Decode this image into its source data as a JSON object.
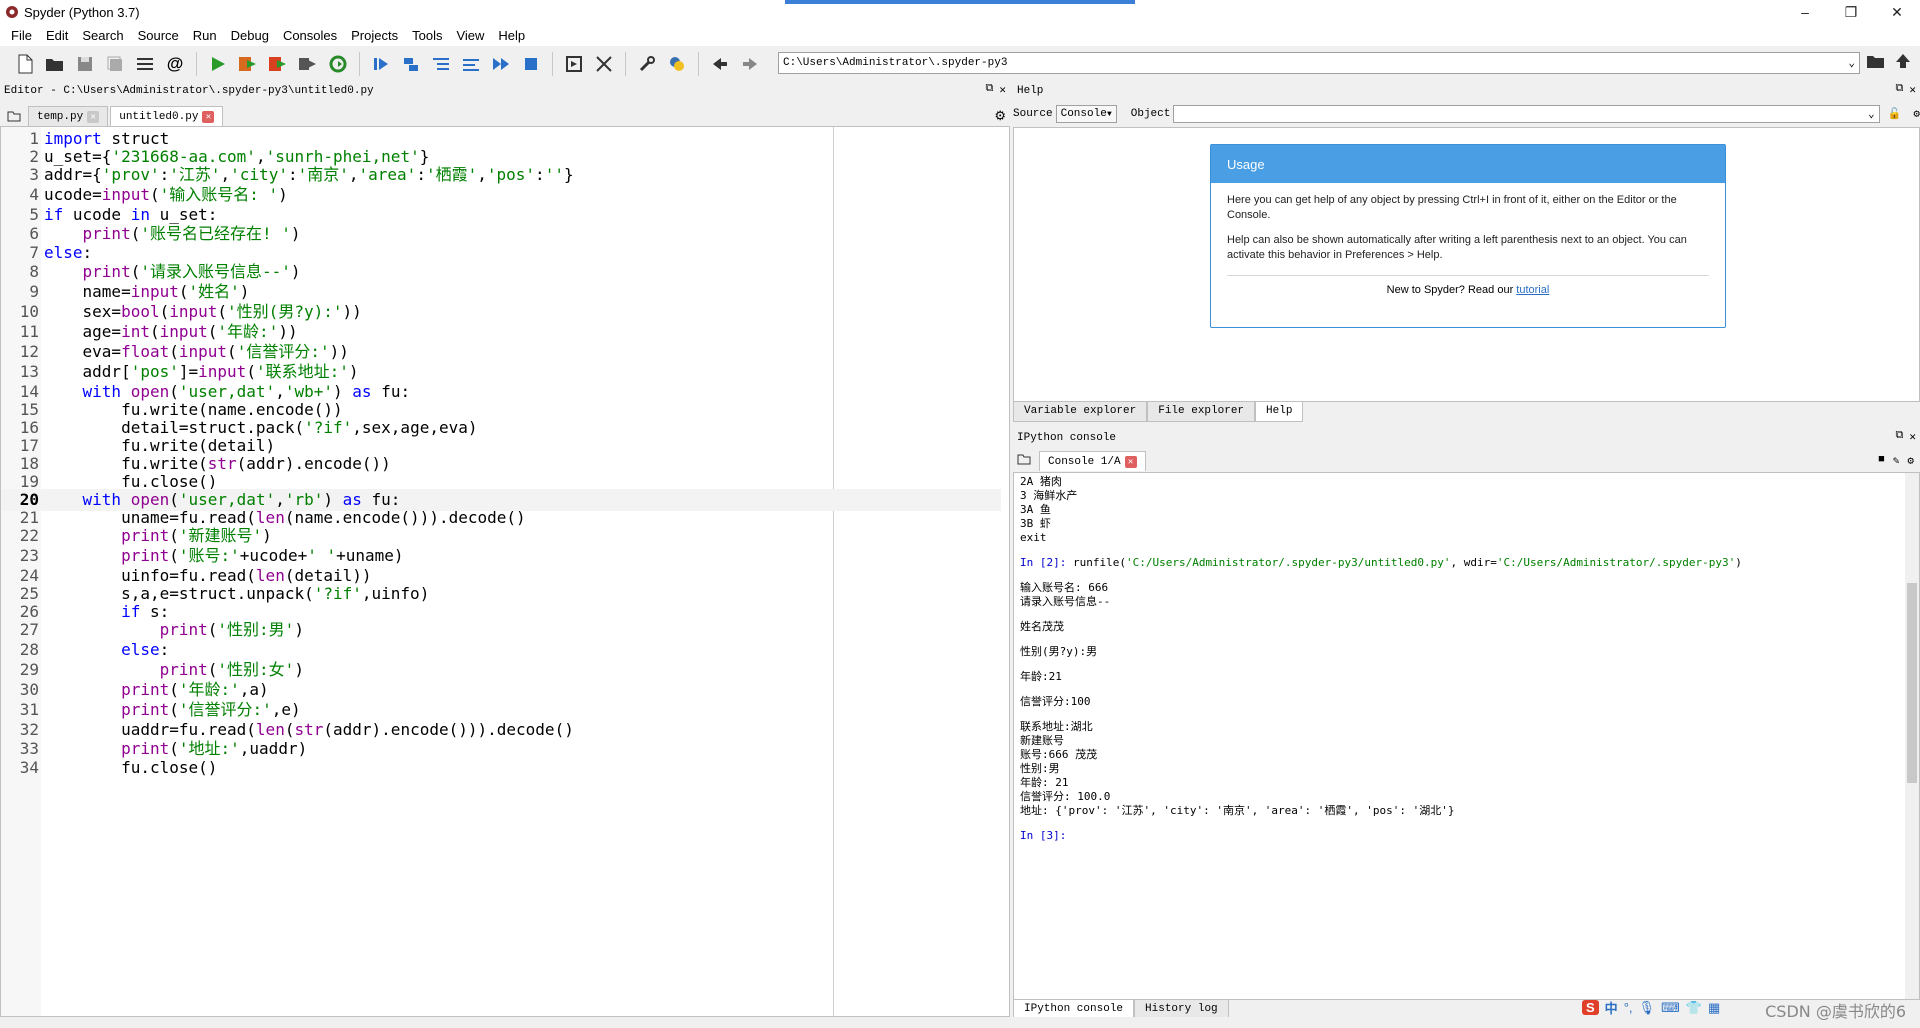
{
  "window": {
    "title": "Spyder (Python 3.7)",
    "minimize": "–",
    "maximize": "❐",
    "close": "✕"
  },
  "menu": [
    "File",
    "Edit",
    "Search",
    "Source",
    "Run",
    "Debug",
    "Consoles",
    "Projects",
    "Tools",
    "View",
    "Help"
  ],
  "toolbar": {
    "path": "C:\\Users\\Administrator\\.spyder-py3"
  },
  "editor": {
    "header": "Editor - C:\\Users\\Administrator\\.spyder-py3\\untitled0.py",
    "tabs": [
      {
        "label": "temp.py"
      },
      {
        "label": "untitled0.py"
      }
    ],
    "current_line": 20
  },
  "help": {
    "header": "Help",
    "source_label": "Source",
    "source_value": "Console",
    "object_label": "Object",
    "object_value": "",
    "usage_title": "Usage",
    "usage_p1": "Here you can get help of any object by pressing Ctrl+I in front of it, either on the Editor or the Console.",
    "usage_p2": "Help can also be shown automatically after writing a left parenthesis next to an object. You can activate this behavior in Preferences > Help.",
    "usage_foot": "New to Spyder? Read our",
    "usage_link": "tutorial",
    "tabs": [
      "Variable explorer",
      "File explorer",
      "Help"
    ]
  },
  "console": {
    "header": "IPython console",
    "tab": "Console 1/A",
    "lines": [
      "2A 猪肉",
      "3 海鲜水产",
      "3A 鱼",
      "3B 虾",
      "exit",
      "",
      "In [2]: runfile('C:/Users/Administrator/.spyder-py3/untitled0.py', wdir='C:/Users/Administrator/.spyder-py3')",
      "",
      "输入账号名: 666",
      "请录入账号信息--",
      "",
      "姓名茂茂",
      "",
      "性别(男?y):男",
      "",
      "年龄:21",
      "",
      "信誉评分:100",
      "",
      "联系地址:湖北",
      "新建账号",
      "账号:666 茂茂",
      "性别:男",
      "年龄: 21",
      "信誉评分: 100.0",
      "地址: {'prov': '江苏', 'city': '南京', 'area': '栖霞', 'pos': '湖北'}",
      "",
      "In [3]:"
    ],
    "bottom_tabs": [
      "IPython console",
      "History log"
    ]
  },
  "watermark": "CSDN @虞书欣的6",
  "ime": {
    "logo": "S",
    "lang": "中",
    "punct": "°,",
    "mic": "🎙",
    "keyboard": "⌨",
    "shirt": "👕",
    "grid": "▦"
  },
  "code_lines": [
    "import struct",
    "u_set={'231668-aa.com','sunrh-phei,net'}",
    "addr={'prov':'江苏','city':'南京','area':'栖霞','pos':''}",
    "ucode=input('输入账号名: ')",
    "if ucode in u_set:",
    "    print('账号名已经存在! ')",
    "else:",
    "    print('请录入账号信息--')",
    "    name=input('姓名')",
    "    sex=bool(input('性别(男?y):'))",
    "    age=int(input('年龄:'))",
    "    eva=float(input('信誉评分:'))",
    "    addr['pos']=input('联系地址:')",
    "    with open('user,dat','wb+') as fu:",
    "        fu.write(name.encode())",
    "        detail=struct.pack('?if',sex,age,eva)",
    "        fu.write(detail)",
    "        fu.write(str(addr).encode())",
    "        fu.close()",
    "    with open('user,dat','rb') as fu:",
    "        uname=fu.read(len(name.encode())).decode()",
    "        print('新建账号')",
    "        print('账号:'+ucode+' '+uname)",
    "        uinfo=fu.read(len(detail))",
    "        s,a,e=struct.unpack('?if',uinfo)",
    "        if s:",
    "            print('性别:男')",
    "        else:",
    "            print('性别:女')",
    "        print('年龄:',a)",
    "        print('信誉评分:',e)",
    "        uaddr=fu.read(len(str(addr).encode())).decode()",
    "        print('地址:',uaddr)",
    "        fu.close()"
  ]
}
